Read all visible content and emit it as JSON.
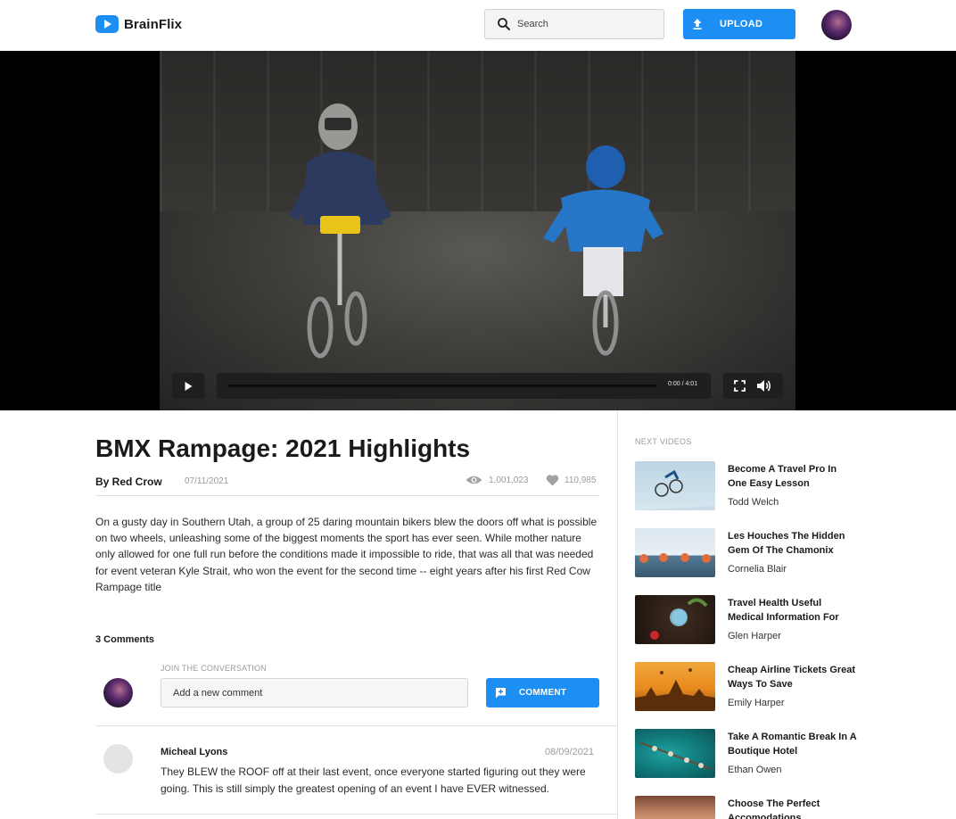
{
  "app": {
    "brand": "BrainFlix",
    "search_placeholder": "Search",
    "upload_label": "UPLOAD"
  },
  "player": {
    "time": "0:00 / 4:01",
    "progress": 0
  },
  "video": {
    "title": "BMX Rampage: 2021 Highlights",
    "author": "By Red Crow",
    "date": "07/11/2021",
    "views": "1,001,023",
    "likes": "110,985",
    "description": "On a gusty day in Southern Utah, a group of 25 daring mountain bikers blew the doors off what is possible on two wheels, unleashing some of the biggest moments the sport has ever seen. While mother nature only allowed for one full run before the conditions made it impossible to ride, that was all that was needed for event veteran Kyle Strait, who won the event for the second time -- eight years after his first Red Cow Rampage title"
  },
  "comments": {
    "count_label": "3 Comments",
    "join_label": "JOIN THE CONVERSATION",
    "input_placeholder": "Add a new comment",
    "button_label": "COMMENT",
    "items": [
      {
        "name": "Micheal Lyons",
        "date": "08/09/2021",
        "text": "They BLEW the ROOF off at their last event, once everyone started figuring out they were going. This is still simply the greatest opening of an event I have EVER witnessed."
      }
    ]
  },
  "sidebar": {
    "heading": "NEXT VIDEOS",
    "items": [
      {
        "title": "Become A Travel Pro In One Easy Lesson",
        "author": "Todd Welch"
      },
      {
        "title": "Les Houches The Hidden Gem Of The Chamonix",
        "author": "Cornelia Blair"
      },
      {
        "title": "Travel Health Useful Medical Information For",
        "author": "Glen Harper"
      },
      {
        "title": "Cheap Airline Tickets Great Ways To Save",
        "author": "Emily Harper"
      },
      {
        "title": "Take A Romantic Break In A Boutique Hotel",
        "author": "Ethan Owen"
      },
      {
        "title": "Choose The Perfect Accomodations",
        "author": ""
      }
    ]
  },
  "colors": {
    "accent": "#1d8ef3"
  }
}
